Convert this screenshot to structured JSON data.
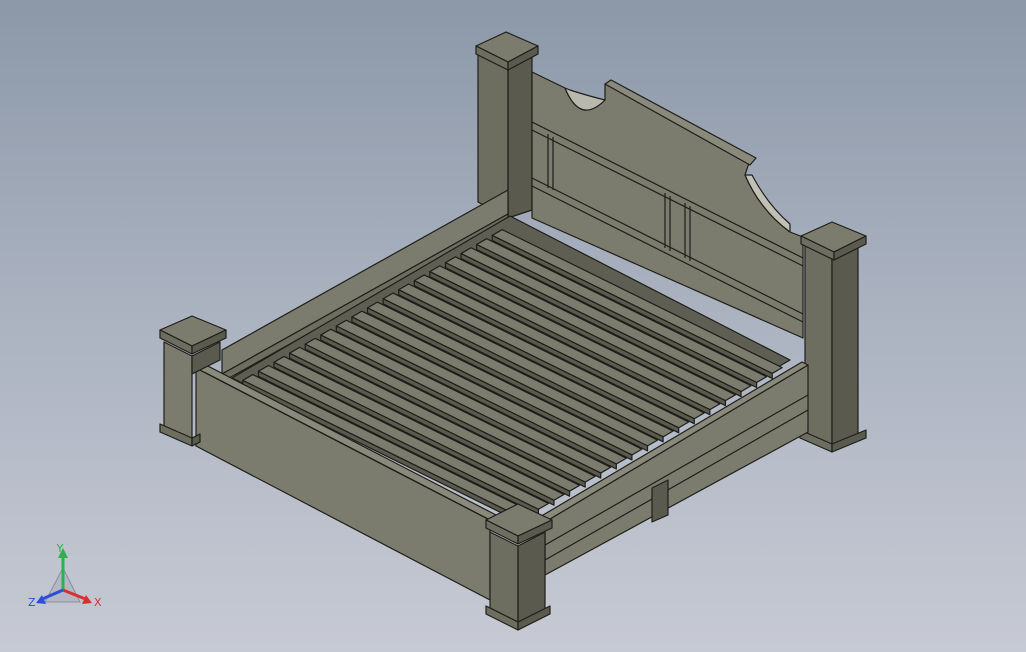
{
  "viewport": {
    "background_top": "#8c98a8",
    "background_bottom": "#c7cad4",
    "model": "bed-frame",
    "view": "isometric"
  },
  "colors": {
    "face_light": "#7c7c6e",
    "face_mid": "#6e6e60",
    "face_dark": "#5a5a4e",
    "edge": "#1e1e1a",
    "highlight": "#b8b8ae"
  },
  "triad": {
    "x_label": "X",
    "y_label": "Y",
    "z_label": "Z",
    "x_color": "#d83030",
    "y_color": "#2fb04a",
    "z_color": "#2b4fd8"
  }
}
